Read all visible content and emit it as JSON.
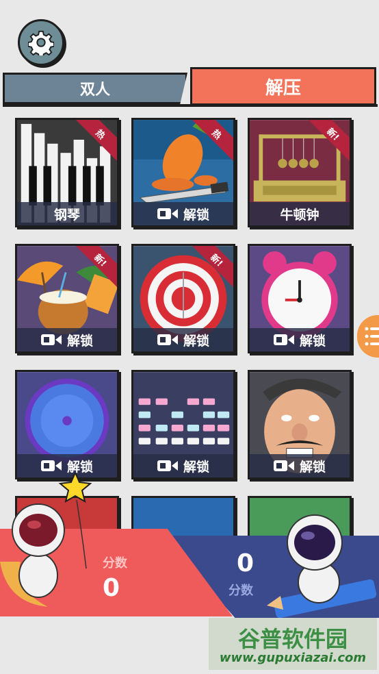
{
  "tabs": {
    "left_label": "双人",
    "right_label": "解压"
  },
  "tiles": [
    {
      "label": "钢琴",
      "locked": false,
      "badge": "热"
    },
    {
      "label": "解锁",
      "locked": true,
      "badge": "热"
    },
    {
      "label": "牛顿钟",
      "locked": false,
      "badge": "新!"
    },
    {
      "label": "解锁",
      "locked": true,
      "badge": "新!"
    },
    {
      "label": "解锁",
      "locked": true,
      "badge": "新!"
    },
    {
      "label": "解锁",
      "locked": true,
      "badge": ""
    },
    {
      "label": "解锁",
      "locked": true,
      "badge": ""
    },
    {
      "label": "解锁",
      "locked": true,
      "badge": ""
    },
    {
      "label": "解锁",
      "locked": true,
      "badge": ""
    }
  ],
  "scores": {
    "left_label": "分数",
    "left_value": "0",
    "right_value": "0",
    "right_label": "分数"
  },
  "watermark": {
    "line1": "谷普软件园",
    "line2": "www.gupuxiazai.com"
  },
  "icons": {
    "settings": "gear-icon",
    "video": "video-camera-icon",
    "menu": "list-menu-icon"
  },
  "colors": {
    "accent": "#f2735a",
    "tab_inactive": "#6c8495",
    "score_left": "#ef5a5a",
    "score_right": "#3a4a8c"
  }
}
